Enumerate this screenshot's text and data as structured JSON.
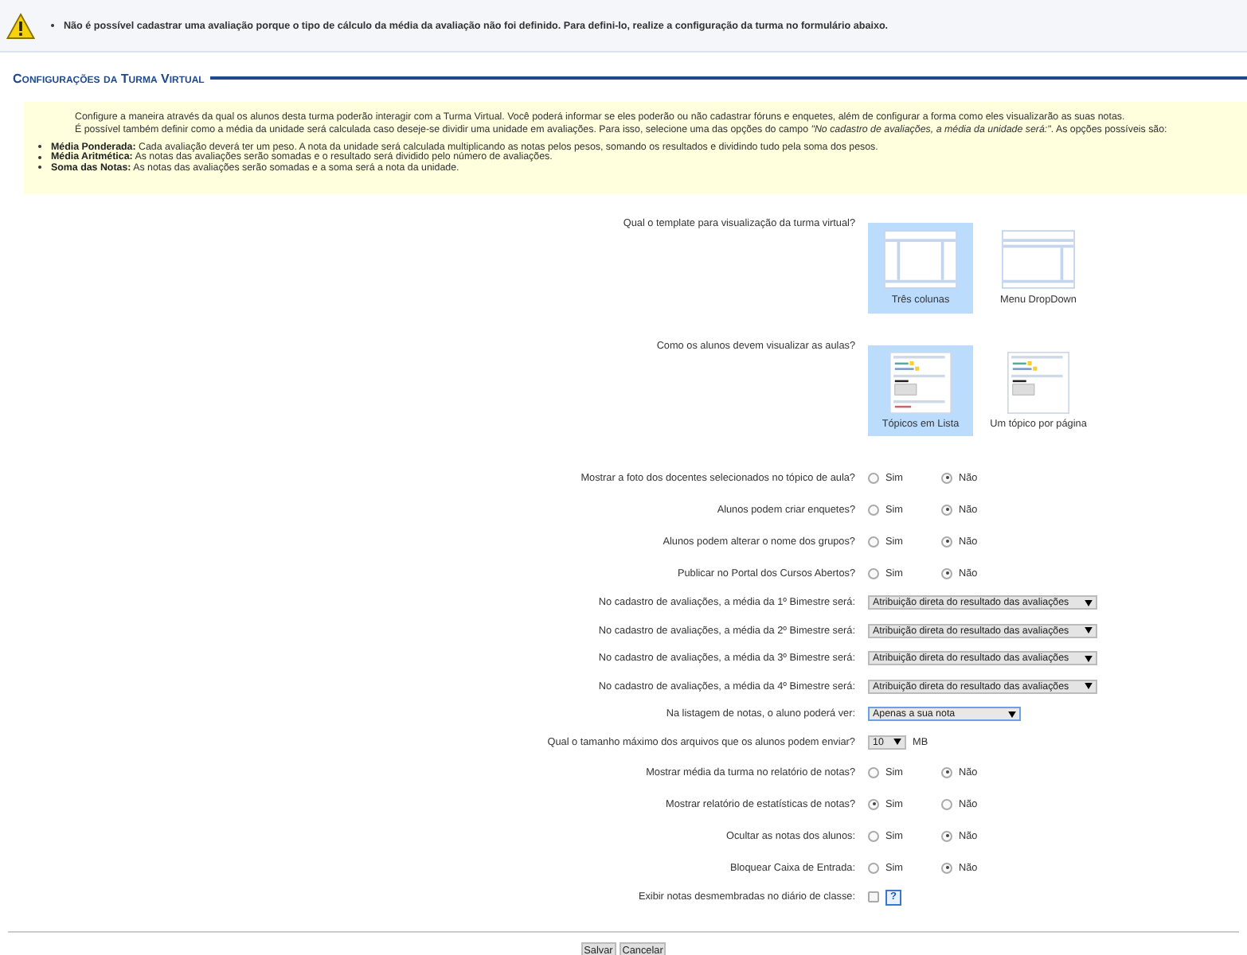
{
  "alert": {
    "message": "Não é possível cadastrar uma avaliação porque o tipo de cálculo da média da avaliação não foi definido. Para defini-lo, realize a configuração da turma no formulário abaixo."
  },
  "section_title": "Configurações da Turma Virtual",
  "info": {
    "paragraphs": [
      "Configure a maneira através da qual os alunos desta turma poderão interagir com a Turma Virtual. Você poderá informar se eles poderão ou não cadastrar fóruns e enquetes, além de configurar a forma como eles visualizarão as suas notas.",
      "É possível também definir como a média da unidade será calculada caso deseje-se dividir uma unidade em avaliações. Para isso, selecione uma das opções do campo *\"No cadastro de avaliações, a média da unidade será:\"*. As opções possíveis são:"
    ],
    "bullets": [
      {
        "term": "Média Ponderada:",
        "text": "Cada avaliação deverá ter um peso. A nota da unidade será calculada multiplicando as notas pelos pesos, somando os resultados e dividindo tudo pela soma dos pesos."
      },
      {
        "term": "Média Aritmética:",
        "text": "As notas das avaliações serão somadas e o resultado será dividido pelo número de avaliações."
      },
      {
        "term": "Soma das Notas:",
        "text": "As notas das avaliações serão somadas e a soma será a nota da unidade."
      }
    ]
  },
  "fields": [
    {
      "kind": "template",
      "label": "Qual o template para visualização da turma virtual?",
      "options": [
        {
          "kind": "three-columns",
          "label": "Três colunas",
          "selected": true
        },
        {
          "kind": "dropdown",
          "label": "Menu DropDown",
          "selected": false
        }
      ]
    },
    {
      "kind": "template",
      "label": "Como os alunos devem visualizar as aulas?",
      "options": [
        {
          "kind": "list",
          "label": "Tópicos em Lista",
          "selected": true
        },
        {
          "kind": "page",
          "label": "Um tópico por página",
          "selected": false
        }
      ]
    },
    {
      "kind": "radio",
      "label": "Mostrar a foto dos docentes selecionados no tópico de aula?",
      "options": [
        {
          "label": "Sim",
          "selected": false
        },
        {
          "label": "Não",
          "selected": true
        }
      ]
    },
    {
      "kind": "radio",
      "label": "Alunos podem criar enquetes?",
      "options": [
        {
          "label": "Sim",
          "selected": false
        },
        {
          "label": "Não",
          "selected": true
        }
      ]
    },
    {
      "kind": "radio",
      "label": "Alunos podem alterar o nome dos grupos?",
      "options": [
        {
          "label": "Sim",
          "selected": false
        },
        {
          "label": "Não",
          "selected": true
        }
      ]
    },
    {
      "kind": "radio",
      "label": "Publicar no Portal dos Cursos Abertos?",
      "options": [
        {
          "label": "Sim",
          "selected": false
        },
        {
          "label": "Não",
          "selected": true
        }
      ]
    },
    {
      "kind": "select",
      "label": "No cadastro de avaliações, a média da 1º Bimestre será:",
      "value": "Atribuição direta do resultado das avaliações"
    },
    {
      "kind": "select",
      "label": "No cadastro de avaliações, a média da 2º Bimestre será:",
      "value": "Atribuição direta do resultado das avaliações"
    },
    {
      "kind": "select",
      "label": "No cadastro de avaliações, a média da 3º Bimestre será:",
      "value": "Atribuição direta do resultado das avaliações"
    },
    {
      "kind": "select",
      "label": "No cadastro de avaliações, a média da 4º Bimestre será:",
      "value": "Atribuição direta do resultado das avaliações"
    },
    {
      "kind": "select-focused",
      "label": "Na listagem de notas, o aluno poderá ver:",
      "value": "Apenas a sua nota"
    },
    {
      "kind": "size",
      "label": "Qual o tamanho máximo dos arquivos que os alunos podem enviar?",
      "value": "10",
      "unit": "MB"
    },
    {
      "kind": "radio",
      "label": "Mostrar média da turma no relatório de notas?",
      "options": [
        {
          "label": "Sim",
          "selected": false
        },
        {
          "label": "Não",
          "selected": true
        }
      ]
    },
    {
      "kind": "radio",
      "label": "Mostrar relatório de estatísticas de notas?",
      "options": [
        {
          "label": "Sim",
          "selected": true
        },
        {
          "label": "Não",
          "selected": false
        }
      ]
    },
    {
      "kind": "radio",
      "label": "Ocultar as notas dos alunos:",
      "options": [
        {
          "label": "Sim",
          "selected": false
        },
        {
          "label": "Não",
          "selected": true
        }
      ]
    },
    {
      "kind": "radio",
      "label": "Bloquear Caixa de Entrada:",
      "options": [
        {
          "label": "Sim",
          "selected": false
        },
        {
          "label": "Não",
          "selected": true
        }
      ]
    },
    {
      "kind": "checkbox",
      "label": "Exibir notas desmembradas no diário de classe:",
      "checked": false,
      "help": "?"
    }
  ],
  "buttons": [
    "Salvar",
    "Cancelar"
  ]
}
